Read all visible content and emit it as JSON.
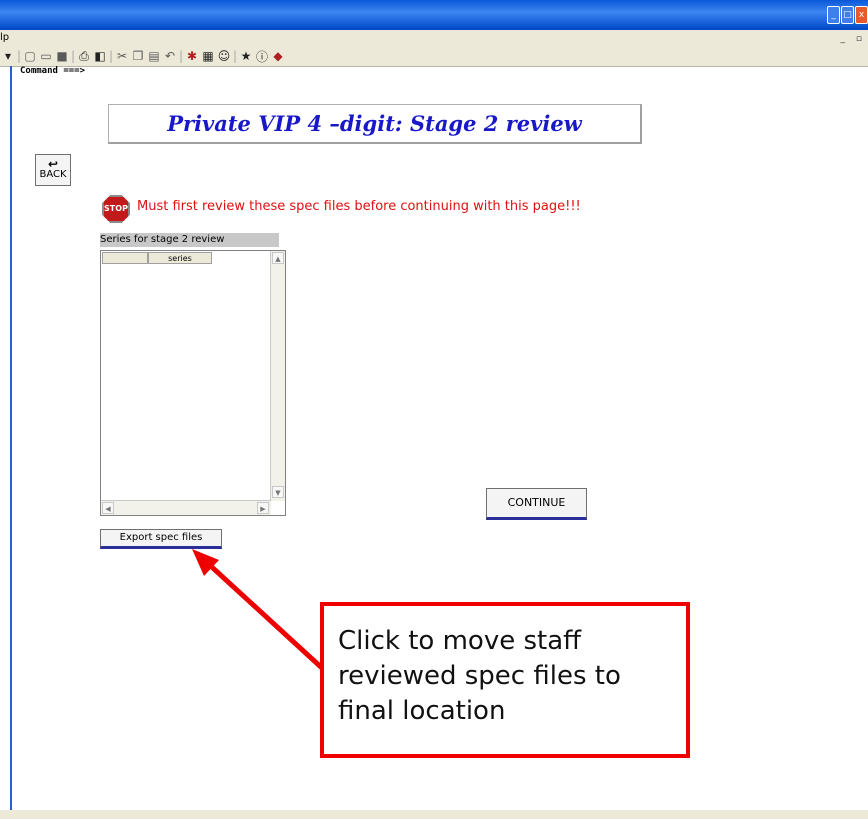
{
  "window": {
    "min_label": "_",
    "max_label": "□",
    "close_label": "x"
  },
  "menubar": {
    "label": "lp",
    "mdi_controls": "_ ▫"
  },
  "toolbar": {
    "icon_names": [
      "new-icon",
      "open-icon",
      "save-icon",
      "print-icon",
      "preview-icon",
      "cut-icon",
      "copy-icon",
      "paste-icon",
      "undo-icon",
      "tool-icon",
      "grid-icon",
      "user-icon",
      "star-icon",
      "info-icon",
      "book-icon"
    ]
  },
  "command_line": "Command ===>",
  "page_title": "Private VIP 4 –digit: Stage 2 review",
  "back_button": {
    "label": "BACK",
    "icon": "↩"
  },
  "stop_icon": {
    "label": "STOP"
  },
  "warning_text": "Must first review these spec files before continuing with this page!!!",
  "list": {
    "caption": "Series for stage 2 review",
    "column_header": "series",
    "rows": []
  },
  "export_button": "Export spec files",
  "continue_button": "CONTINUE",
  "callout": {
    "text": "Click to move staff reviewed spec files to final location",
    "color": "#ee0000"
  }
}
